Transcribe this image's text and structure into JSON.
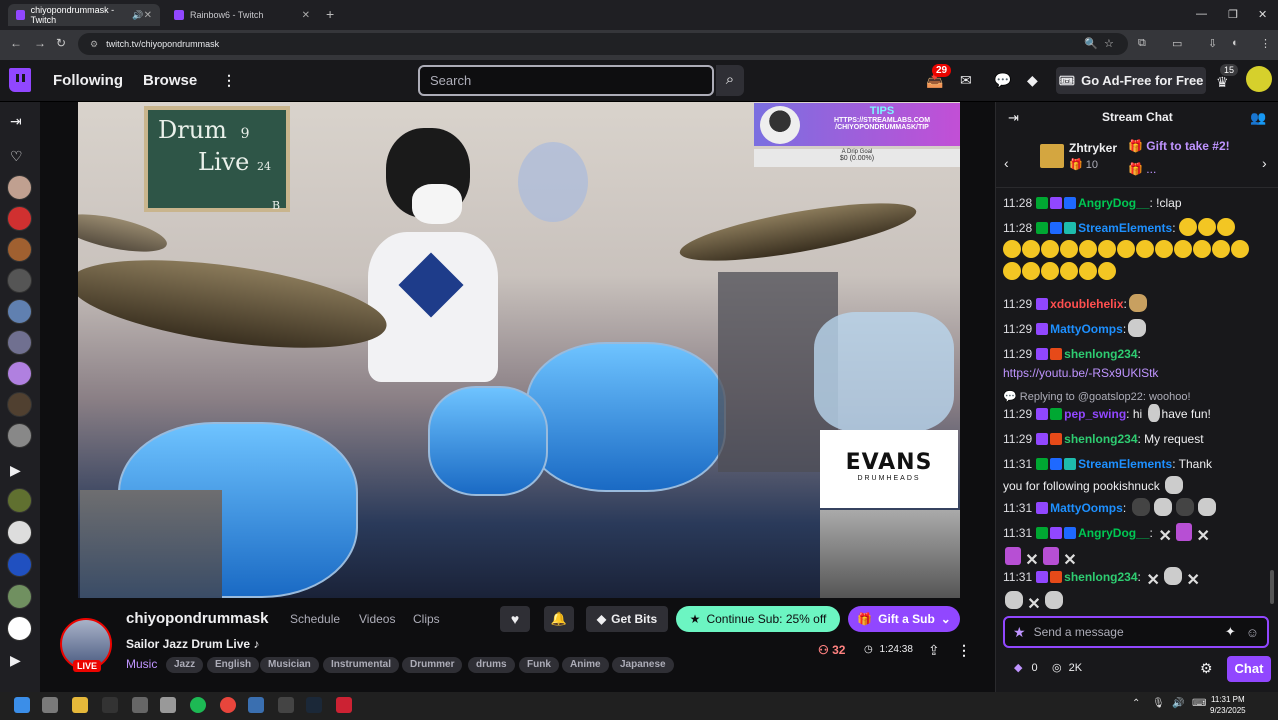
{
  "browser": {
    "tabs": [
      {
        "title": "chiyopondrummask - Twitch",
        "audio_icon": "speaker-icon"
      },
      {
        "title": "Rainbow6 - Twitch"
      }
    ],
    "url": "twitch.tv/chiyopondrummask"
  },
  "topnav": {
    "following": "Following",
    "browse": "Browse",
    "search_placeholder": "Search",
    "notifications_count": "29",
    "ad_free_label": "Go Ad-Free for Free",
    "prime_count": "15"
  },
  "video": {
    "chalkboard_line1": "Drum",
    "chalkboard_line2": "Live",
    "chalkboard_num1": "9",
    "chalkboard_num2": "24",
    "chalkboard_letter": "B",
    "tips_title": "TIPS",
    "tips_line1": "HTTPS://STREAMLABS.COM",
    "tips_line2": "/CHIYOPONDRUMMASK/TIP",
    "goal_label": "A Drip Goal",
    "goal_value": "$0 (0.00%)",
    "sponsor_brand": "EVANS",
    "sponsor_sub": "DRUMHEADS"
  },
  "channel": {
    "name": "chiyopondrummask",
    "links": [
      "Schedule",
      "Videos",
      "Clips"
    ],
    "title": "Sailor Jazz Drum Live ♪",
    "category": "Music",
    "tags": [
      "Jazz",
      "English",
      "Musician",
      "Instrumental",
      "Drummer",
      "drums",
      "Funk",
      "Anime",
      "Japanese"
    ],
    "live_badge": "LIVE",
    "get_bits": "Get Bits",
    "continue_sub": "Continue Sub: 25% off",
    "gift_sub": "Gift a Sub",
    "viewers": "32",
    "uptime": "1:24:38"
  },
  "chat": {
    "title": "Stream Chat",
    "gifter_name": "Zhtryker",
    "gifter_count": "10",
    "gift_cta": "Gift to take #2!",
    "gift_more": "...",
    "messages": [
      {
        "time": "11:28",
        "user": "AngryDog__",
        "color": "#00c853",
        "text": ": !clap"
      },
      {
        "time": "11:28",
        "user": "StreamElements",
        "color": "#1e90ff",
        "text": ":"
      },
      {
        "time": "11:29",
        "user": "xdoublehelix",
        "color": "#ff4f4f",
        "text": ":"
      },
      {
        "time": "11:29",
        "user": "MattyOomps",
        "color": "#1e90ff",
        "text": ":"
      },
      {
        "time": "11:29",
        "user": "shenlong234",
        "color": "#2ecc71",
        "text": ":"
      },
      {
        "link": "https://youtu.be/-RSx9UKlStk"
      },
      {
        "reply": "Replying to @goatslop22: woohoo!"
      },
      {
        "time": "11:29",
        "user": "pep_swing",
        "color": "#9147ff",
        "text": ": hi",
        "text2": "have fun!"
      },
      {
        "time": "11:29",
        "user": "shenlong234",
        "color": "#2ecc71",
        "text": ": My request"
      },
      {
        "time": "11:31",
        "user": "StreamElements",
        "color": "#1e90ff",
        "text": ": Thank",
        "text2": "you for following pookishnuck"
      },
      {
        "time": "11:31",
        "user": "MattyOomps",
        "color": "#1e90ff",
        "text": ":"
      },
      {
        "time": "11:31",
        "user": "AngryDog__",
        "color": "#00c853",
        "text": ":"
      },
      {
        "time": "11:31",
        "user": "shenlong234",
        "color": "#2ecc71",
        "text": ":"
      }
    ],
    "input_placeholder": "Send a message",
    "bits": "0",
    "points": "2K",
    "chat_button": "Chat"
  },
  "taskbar": {
    "time": "11:31 PM",
    "date": "9/23/2025"
  }
}
